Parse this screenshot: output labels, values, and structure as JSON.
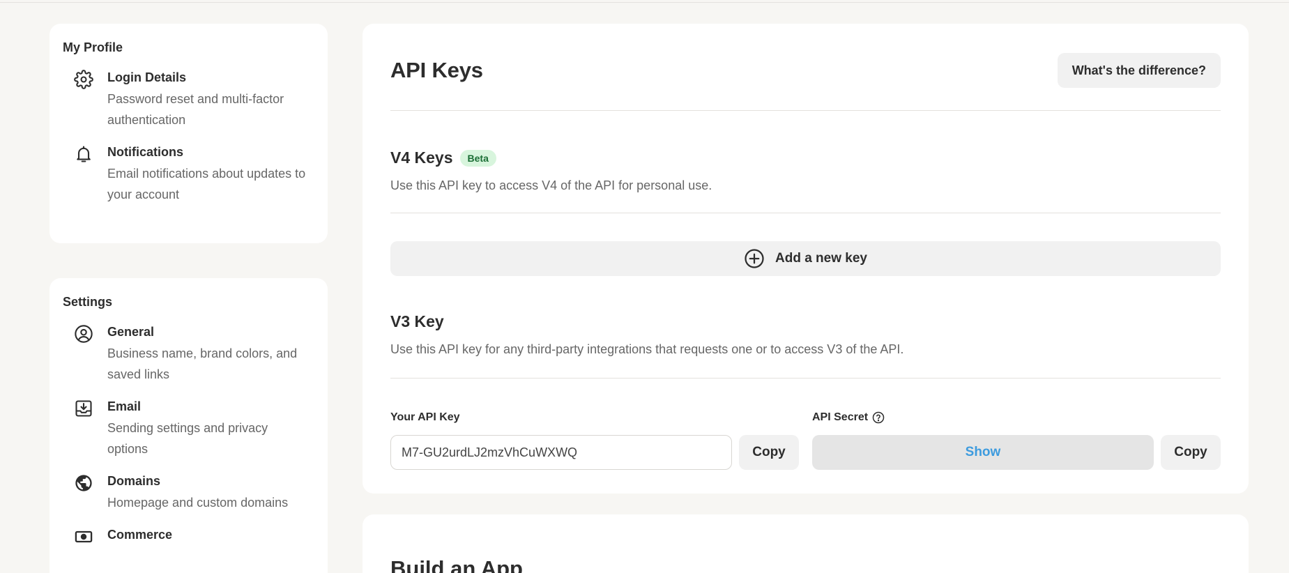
{
  "profile": {
    "title": "My Profile",
    "items": [
      {
        "icon": "gear-icon",
        "label": "Login Details",
        "desc": "Password reset and multi-factor authentication"
      },
      {
        "icon": "bell-icon",
        "label": "Notifications",
        "desc": "Email notifications about updates to your account"
      }
    ]
  },
  "settings": {
    "title": "Settings",
    "items": [
      {
        "icon": "user-circle-icon",
        "label": "General",
        "desc": "Business name, brand colors, and saved links"
      },
      {
        "icon": "inbox-download-icon",
        "label": "Email",
        "desc": "Sending settings and privacy options"
      },
      {
        "icon": "globe-icon",
        "label": "Domains",
        "desc": "Homepage and custom domains"
      },
      {
        "icon": "banknote-icon",
        "label": "Commerce",
        "desc": ""
      }
    ]
  },
  "main": {
    "title": "API Keys",
    "diff_button": "What's the difference?",
    "v4": {
      "title": "V4 Keys",
      "badge": "Beta",
      "desc": "Use this API key to access V4 of the API for personal use.",
      "add_button": "Add a new key"
    },
    "v3": {
      "title": "V3 Key",
      "desc": "Use this API key for any third-party integrations that requests one or to access V3 of the API.",
      "api_key_label": "Your API Key",
      "api_key_value": "M7-GU2urdLJ2mzVhCuWXWQ",
      "copy_label": "Copy",
      "api_secret_label": "API Secret",
      "show_label": "Show",
      "copy_secret_label": "Copy"
    }
  },
  "build": {
    "title": "Build an App"
  },
  "colors": {
    "accent_link": "#3d9bde",
    "badge_bg": "#d8f5dd",
    "badge_text": "#1b6e35",
    "background": "#f7f6f3"
  }
}
